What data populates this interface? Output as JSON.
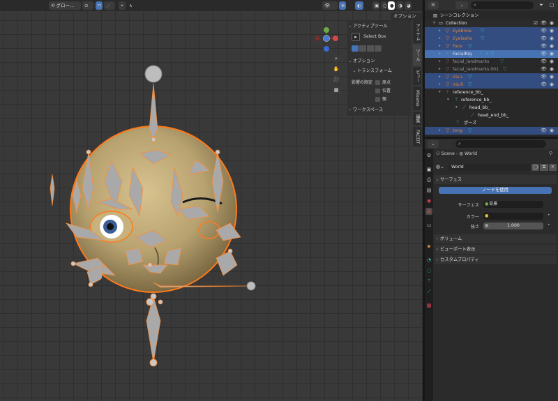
{
  "viewport": {
    "header": {
      "transform_orientation": "グロー...",
      "options_label": "オプション"
    },
    "npanel": {
      "active_tool_title": "アクティブツール",
      "select_tool": "Select Box",
      "options_title": "オプション",
      "transform_title": "トランスフォーム",
      "affect_only_label": "影響の限定",
      "affect_options": [
        "原点",
        "位置",
        "親"
      ],
      "workspace_title": "ワークスペース"
    },
    "side_tabs": [
      "アイテム",
      "ツール",
      "ビュー",
      "Mixamo",
      "編集",
      "FACEIT"
    ]
  },
  "outliner": {
    "title": "シーンコレクション",
    "rows": [
      {
        "name": "Collection",
        "style": "white",
        "indent": 1
      },
      {
        "name": "EyeBrow",
        "style": "orange",
        "indent": 2,
        "selected": true
      },
      {
        "name": "Eyelashe",
        "style": "orange",
        "indent": 2,
        "selected": true
      },
      {
        "name": "Face",
        "style": "orange",
        "indent": 2,
        "selected": true
      },
      {
        "name": "FacialRig",
        "style": "white",
        "indent": 2,
        "selected": true,
        "active": true
      },
      {
        "name": "facial_landmarks",
        "style": "dim",
        "indent": 2
      },
      {
        "name": "facial_landmarks.001",
        "style": "dim",
        "indent": 2
      },
      {
        "name": "iris.L",
        "style": "orange",
        "indent": 2,
        "selected": true
      },
      {
        "name": "iris.R",
        "style": "orange",
        "indent": 2,
        "selected": true
      },
      {
        "name": "reference_bb_",
        "style": "white",
        "indent": 2
      },
      {
        "name": "reference_bb_",
        "style": "white",
        "indent": 3
      },
      {
        "name": "head_bb_",
        "style": "white",
        "indent": 4
      },
      {
        "name": "head_end_bb_",
        "style": "white",
        "indent": 5
      },
      {
        "name": "ポーズ",
        "style": "white",
        "indent": 4
      },
      {
        "name": "tong",
        "style": "orange",
        "indent": 2,
        "selected": true
      }
    ]
  },
  "properties": {
    "breadcrumb": {
      "scene": "Scene",
      "world": "World"
    },
    "world_name": "World",
    "sections": {
      "surface": "サーフェス",
      "use_nodes": "ノードを使用",
      "surface_label": "サーフェス",
      "surface_value": "背景",
      "color_label": "カラー",
      "strength_label": "強さ",
      "strength_value": "1.000",
      "volume": "ボリューム",
      "viewport_display": "ビューポート表示",
      "custom_props": "カスタムプロパティ"
    }
  },
  "colors": {
    "accent_blue": "#4772b3",
    "selection_blue": "#334d80",
    "orange": "#e0823e",
    "rig_gray": "#a9a9a9",
    "head_gold": "#b7a270"
  }
}
